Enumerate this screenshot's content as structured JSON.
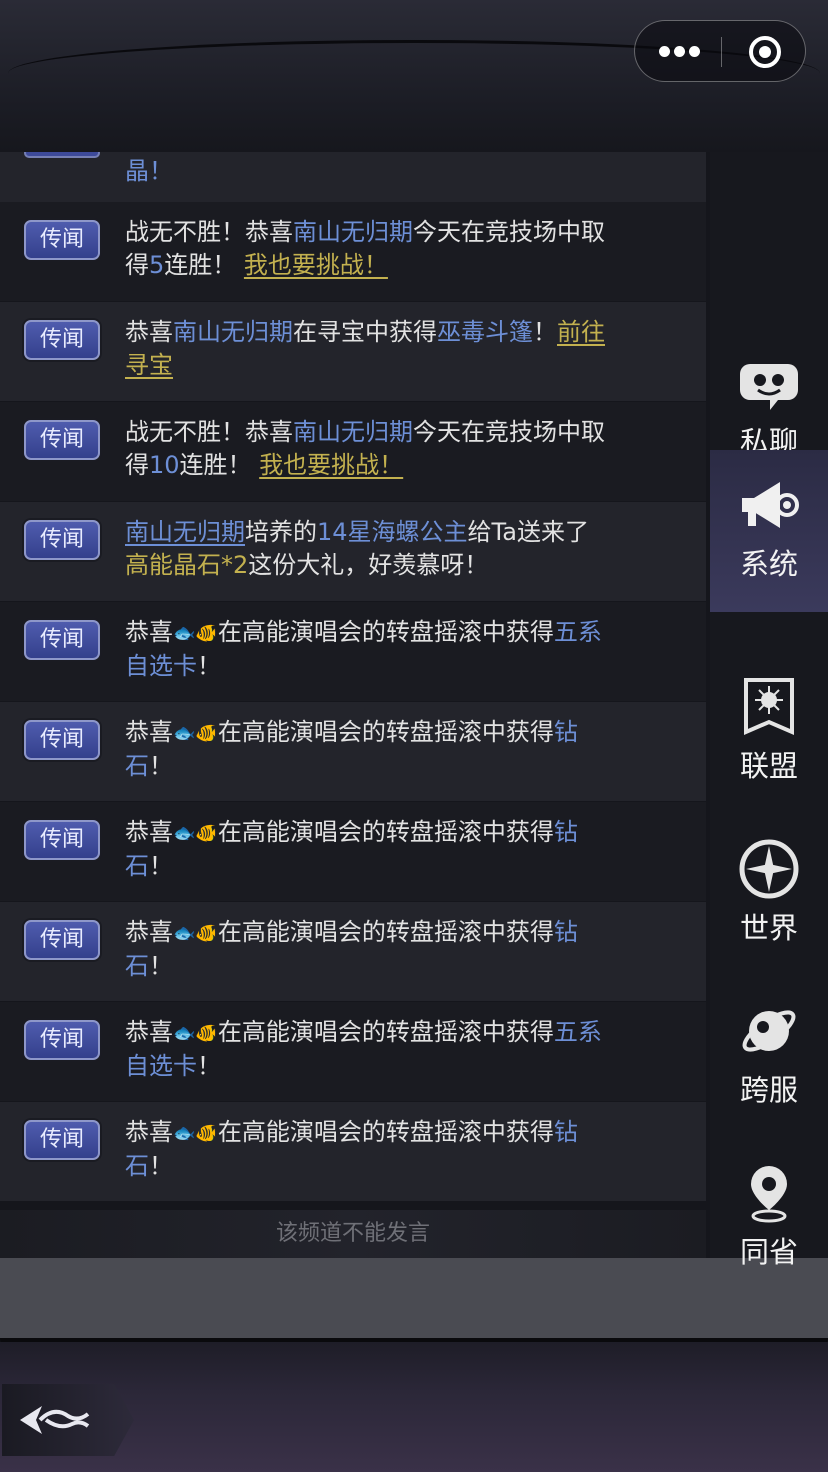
{
  "header": {
    "more_icon": "more-dots-icon",
    "close_icon": "target-icon"
  },
  "partial": {
    "text": "晶！"
  },
  "tag_label": "传闻",
  "rows": [
    {
      "p1": "战无不胜！恭喜",
      "name": "南山无归期",
      "p2": "今天在竞技场中取得",
      "num": "5",
      "p3": "连胜！",
      "link": "我也要挑战！"
    },
    {
      "p1": "恭喜",
      "name": "南山无归期",
      "p2": "在寻宝中获得",
      "item": "巫毒斗篷",
      "p3": "！",
      "link": "前往寻宝"
    },
    {
      "p1": "战无不胜！恭喜",
      "name": "南山无归期",
      "p2": "今天在竞技场中取得",
      "num": "10",
      "p3": "连胜！",
      "link": "我也要挑战！"
    },
    {
      "name": "南山无归期",
      "p1": "培养的",
      "hero": "14星海螺公主",
      "p2": "给Ta送来了",
      "gift": "高能晶石*2",
      "p3": "这份大礼，好羡慕呀！"
    },
    {
      "p1": "恭喜",
      "fish": "🐟🐠",
      "p2": "在高能演唱会的转盘摇滚中获得",
      "prize": "五系自选卡",
      "p3": "！"
    },
    {
      "p1": "恭喜",
      "fish": "🐟🐠",
      "p2": "在高能演唱会的转盘摇滚中获得",
      "prize": "钻石",
      "p3": "！"
    },
    {
      "p1": "恭喜",
      "fish": "🐟🐠",
      "p2": "在高能演唱会的转盘摇滚中获得",
      "prize": "钻石",
      "p3": "！"
    },
    {
      "p1": "恭喜",
      "fish": "🐟🐠",
      "p2": "在高能演唱会的转盘摇滚中获得",
      "prize": "钻石",
      "p3": "！"
    },
    {
      "p1": "恭喜",
      "fish": "🐟🐠",
      "p2": "在高能演唱会的转盘摇滚中获得",
      "prize": "五系自选卡",
      "p3": "！"
    },
    {
      "p1": "恭喜",
      "fish": "🐟🐠",
      "p2": "在高能演唱会的转盘摇滚中获得",
      "prize": "钻石",
      "p3": "！"
    }
  ],
  "footer_note": "该频道不能发言",
  "sidebar": [
    {
      "label": "私聊",
      "icon": "chat-face-icon"
    },
    {
      "label": "系统",
      "icon": "megaphone-icon",
      "active": true
    },
    {
      "label": "联盟",
      "icon": "banner-icon"
    },
    {
      "label": "世界",
      "icon": "compass-icon"
    },
    {
      "label": "跨服",
      "icon": "planet-icon"
    },
    {
      "label": "同省",
      "icon": "location-pin-icon"
    }
  ],
  "colors": {
    "name": "#6d8fd6",
    "highlight": "#c3b14f",
    "active_tab": "#3b3a5c"
  }
}
